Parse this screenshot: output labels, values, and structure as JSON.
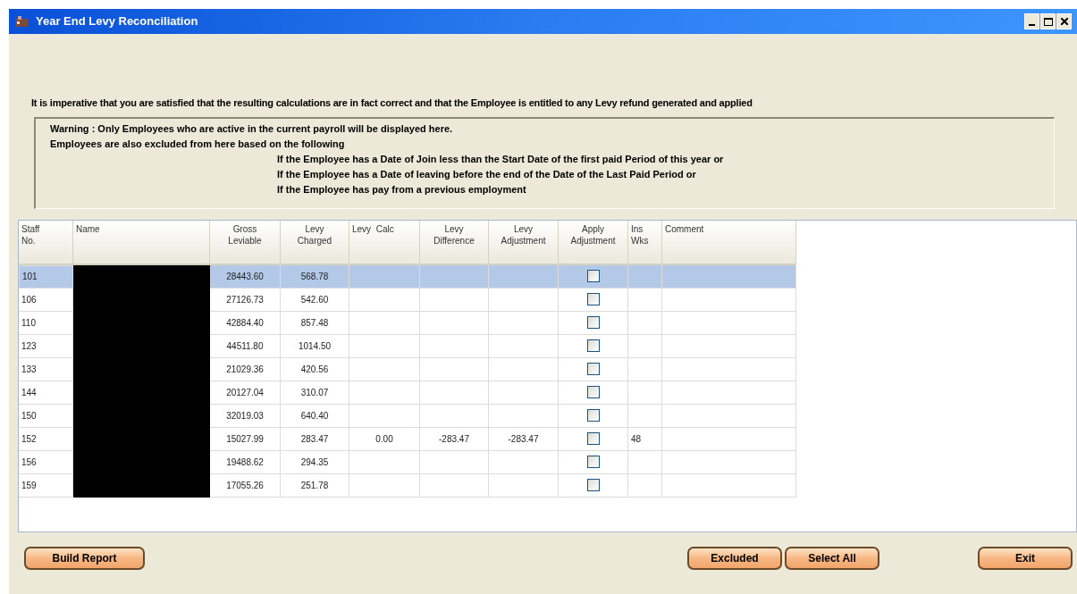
{
  "window": {
    "title": "Year End Levy Reconciliation"
  },
  "notice": "It is imperative that you are satisfied that the resulting calculations are in fact correct and that the Employee is entitled to any Levy refund generated and applied",
  "warning": {
    "lines": [
      "Warning : Only Employees who are active in the current payroll will be displayed here.",
      "Employees are also excluded from here based on the following"
    ],
    "conditions": [
      "If the Employee has a Date of Join less than the Start Date of the first paid Period of this year or",
      "If the Employee has a Date of leaving before the end of the Date of the Last Paid Period or",
      "If the Employee has pay from a previous employment"
    ]
  },
  "table": {
    "columns": [
      "Staff No.",
      "Name",
      "Gross Leviable",
      "Levy Charged",
      "Levy  Calc",
      "Levy Difference",
      "Levy Adjustment",
      "Apply Adjustment",
      "Ins Wks",
      "Comment"
    ],
    "rows": [
      {
        "staff_no": "101",
        "gross": "28443.60",
        "charged": "568.78",
        "selected": true,
        "apply": false
      },
      {
        "staff_no": "106",
        "gross": "27126.73",
        "charged": "542.60",
        "selected": false,
        "apply": false
      },
      {
        "staff_no": "110",
        "gross": "42884.40",
        "charged": "857.48",
        "selected": false,
        "apply": false
      },
      {
        "staff_no": "123",
        "gross": "44511.80",
        "charged": "1014.50",
        "selected": false,
        "apply": false
      },
      {
        "staff_no": "133",
        "gross": "21029.36",
        "charged": "420.56",
        "selected": false,
        "apply": false
      },
      {
        "staff_no": "144",
        "gross": "20127.04",
        "charged": "310.07",
        "selected": false,
        "apply": false
      },
      {
        "staff_no": "150",
        "gross": "32019.03",
        "charged": "640.40",
        "selected": false,
        "apply": false
      },
      {
        "staff_no": "152",
        "gross": "15027.99",
        "charged": "283.47",
        "calc": "0.00",
        "difference": "-283.47",
        "adjustment": "-283.47",
        "ins_wks": "48",
        "selected": false,
        "apply": false
      },
      {
        "staff_no": "156",
        "gross": "19488.62",
        "charged": "294.35",
        "selected": false,
        "apply": false
      },
      {
        "staff_no": "159",
        "gross": "17055.26",
        "charged": "251.78",
        "selected": false,
        "apply": false
      }
    ]
  },
  "buttons": {
    "left": [
      "Build Report"
    ],
    "middle": [
      "Excluded",
      "Select All"
    ],
    "right": [
      "Exit"
    ]
  }
}
